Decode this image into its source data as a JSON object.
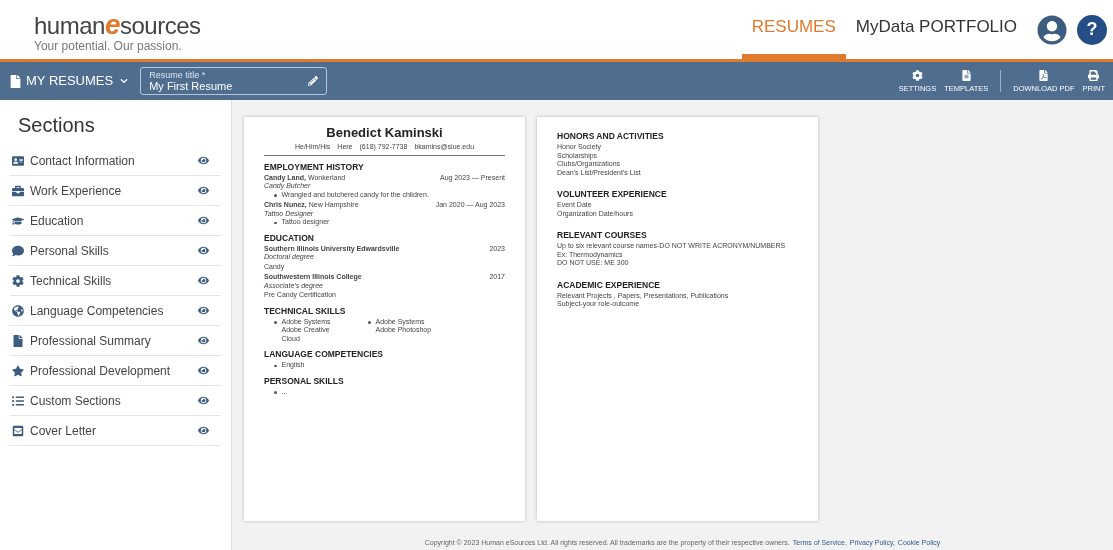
{
  "logo": {
    "wordmark_left": "human",
    "wordmark_mark": "e",
    "wordmark_right": "sources",
    "tagline": "Your potential. Our passion."
  },
  "nav": {
    "tabs": [
      {
        "label": "RESUMES",
        "selected": true
      },
      {
        "label": "MyData PORTFOLIO",
        "selected": false
      }
    ],
    "help": "?"
  },
  "toolbar": {
    "menu": "MY RESUMES",
    "title_field": {
      "label": "Resume title *",
      "value": "My First Resume"
    },
    "actions": [
      {
        "kind": "settings",
        "label": "SETTINGS"
      },
      {
        "kind": "templates",
        "label": "TEMPLATES"
      },
      {
        "kind": "pdf",
        "label": "DOWNLOAD PDF"
      },
      {
        "kind": "print",
        "label": "PRINT"
      }
    ]
  },
  "sidebar": {
    "heading": "Sections",
    "items": [
      {
        "kind": "contact",
        "label": "Contact Information",
        "visible": true
      },
      {
        "kind": "work",
        "label": "Work Experience",
        "visible": true
      },
      {
        "kind": "education",
        "label": "Education",
        "visible": true
      },
      {
        "kind": "personal",
        "label": "Personal Skills",
        "visible": true
      },
      {
        "kind": "technical",
        "label": "Technical Skills",
        "visible": true
      },
      {
        "kind": "language",
        "label": "Language Competencies",
        "visible": true
      },
      {
        "kind": "summary",
        "label": "Professional Summary",
        "visible": true
      },
      {
        "kind": "development",
        "label": "Professional Development",
        "visible": true
      },
      {
        "kind": "custom",
        "label": "Custom Sections",
        "visible": true
      },
      {
        "kind": "cover",
        "label": "Cover Letter",
        "visible": true
      }
    ]
  },
  "resume": {
    "name": "Benedict Kaminski",
    "contacts": [
      "He/Him/His",
      "Here",
      "(618) 792-7738",
      "bkamins@siue.edu"
    ],
    "pages": [
      [
        {
          "kind": "entries",
          "heading": "EMPLOYMENT HISTORY",
          "entries": [
            {
              "title": "Candy Land,",
              "place": " Wonkerland",
              "date": "Aug 2023 — Present",
              "subtitle": "Candy Butcher",
              "bullets": [
                "Wrangled and butchered candy for the children."
              ]
            },
            {
              "title": "Chris Nunez,",
              "place": " New Hampshire",
              "date": "Jan 2020 — Aug 2023",
              "subtitle": "Tattoo Designer",
              "bullets": [
                "Tattoo designer"
              ]
            }
          ]
        },
        {
          "kind": "entries",
          "heading": "EDUCATION",
          "entries": [
            {
              "title": "Southern Illinois University Edwardsville",
              "date": "2023",
              "subtitle": "Doctoral degree",
              "note": "Candy"
            },
            {
              "title": "Southwestern Illinois College",
              "date": "2017",
              "subtitle": "Associate's degree",
              "note": "Pre Candy Certification"
            }
          ]
        },
        {
          "kind": "columns",
          "heading": "TECHNICAL SKILLS",
          "columns": [
            [
              "Adobe Systems",
              "Adobe Creative",
              "Cloud"
            ],
            [
              "Adobe Systems",
              "Adobe Photoshop"
            ]
          ]
        },
        {
          "kind": "bullets",
          "heading": "LANGUAGE COMPETENCIES",
          "items": [
            "English"
          ]
        },
        {
          "kind": "bullets",
          "heading": "PERSONAL SKILLS",
          "items": [
            "..."
          ]
        }
      ],
      [
        {
          "kind": "lines",
          "heading": "HONORS AND ACTIVITIES",
          "items": [
            "Honor Society",
            "Scholarships",
            "Clubs/Organizations",
            "Dean's List/President's List"
          ]
        },
        {
          "kind": "lines",
          "heading": "VOLUNTEER EXPERIENCE",
          "items": [
            "Event Date",
            "Organization Date/hours"
          ]
        },
        {
          "kind": "lines",
          "heading": "RELEVANT COURSES",
          "items": [
            "Up to six relevant course names-DO NOT WRITE ACRONYM/NUMBERS",
            "Ex: Thermodynamics",
            "DO NOT USE: ME 300"
          ]
        },
        {
          "kind": "lines",
          "heading": "ACADEMIC EXPERIENCE",
          "items": [
            "Relevant Projects , Papers, Presentations, Publications",
            "Subject-your role-outcome"
          ]
        }
      ]
    ]
  },
  "footer": {
    "text": "Copyright © 2023 Human eSources Ltd. All rights reserved. All trademarks are the property of their respective owners.",
    "links": [
      "Terms of Service,",
      "Privacy Policy,",
      "Cookie Policy"
    ]
  }
}
